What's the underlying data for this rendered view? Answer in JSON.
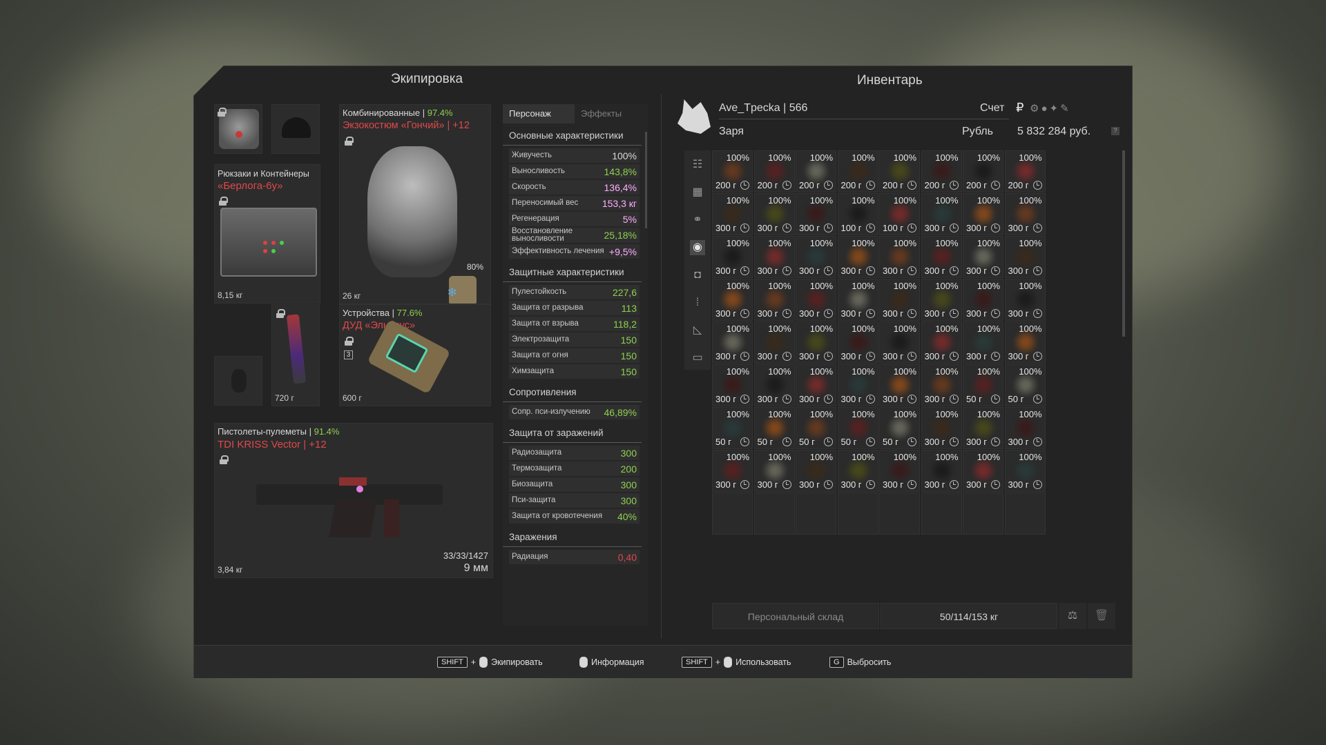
{
  "equipment": {
    "title": "Экипировка",
    "backpack": {
      "category": "Рюкзаки и Контейнеры",
      "name": "«Берлога-6у»",
      "weight": "8,15 кг"
    },
    "armor": {
      "category": "Комбинированные",
      "durability": "97.4%",
      "name": "Экзокостюм «Гончий» | +12",
      "weight": "26 кг",
      "plate_pct": "80%"
    },
    "knife": {
      "weight": "720 г"
    },
    "device": {
      "category": "Устройства",
      "durability": "77.6%",
      "name": "ДУД «Эльбрус»",
      "weight": "600 г",
      "badge": "3"
    },
    "weapon": {
      "category": "Пистолеты-пулеметы",
      "durability": "91.4%",
      "name": "TDI KRISS Vector | +12",
      "weight": "3,84 кг",
      "ammo": "33/33/1427",
      "caliber": "9 мм"
    }
  },
  "stats": {
    "tab_character": "Персонаж",
    "tab_effects": "Эффекты",
    "sections": [
      {
        "title": "Основные характеристики",
        "rows": [
          {
            "label": "Живучесть",
            "value": "100%",
            "color": "w"
          },
          {
            "label": "Выносливость",
            "value": "143,8%",
            "color": "g"
          },
          {
            "label": "Скорость",
            "value": "136,4%",
            "color": "p"
          },
          {
            "label": "Переносимый вес",
            "value": "153,3 кг",
            "color": "p"
          },
          {
            "label": "Регенерация",
            "value": "5%",
            "color": "p"
          },
          {
            "label": "Восстановление выносливости",
            "value": "25,18%",
            "color": "g"
          },
          {
            "label": "Эффективность лечения",
            "value": "+9,5%",
            "color": "p"
          }
        ]
      },
      {
        "title": "Защитные характеристики",
        "rows": [
          {
            "label": "Пулестойкость",
            "value": "227,6",
            "color": "g"
          },
          {
            "label": "Защита от разрыва",
            "value": "113",
            "color": "g"
          },
          {
            "label": "Защита от взрыва",
            "value": "118,2",
            "color": "g"
          },
          {
            "label": "Электрозащита",
            "value": "150",
            "color": "g"
          },
          {
            "label": "Защита от огня",
            "value": "150",
            "color": "g"
          },
          {
            "label": "Химзащита",
            "value": "150",
            "color": "g"
          }
        ]
      },
      {
        "title": "Сопротивления",
        "rows": [
          {
            "label": "Сопр. пси-излучению",
            "value": "46,89%",
            "color": "g"
          }
        ]
      },
      {
        "title": "Защита от заражений",
        "rows": [
          {
            "label": "Радиозащита",
            "value": "300",
            "color": "g"
          },
          {
            "label": "Термозащита",
            "value": "200",
            "color": "g"
          },
          {
            "label": "Биозащита",
            "value": "300",
            "color": "g"
          },
          {
            "label": "Пси-защита",
            "value": "300",
            "color": "g"
          },
          {
            "label": "Защита от кровотечения",
            "value": "40%",
            "color": "g"
          }
        ]
      },
      {
        "title": "Заражения",
        "rows": [
          {
            "label": "Радиация",
            "value": "0,40",
            "color": "r"
          }
        ]
      }
    ]
  },
  "inventory": {
    "title": "Инвентарь",
    "player": "Ave_Tpecka | 566",
    "faction": "Заря",
    "account_label": "Счет",
    "currency_label": "Рубль",
    "balance": "5 832 284 руб.",
    "storage_label": "Персональный склад",
    "weight": "50/114/153 кг",
    "grid": [
      [
        "200 г",
        "200 г",
        "200 г",
        "200 г",
        "200 г",
        "200 г",
        "200 г",
        "200 г"
      ],
      [
        "300 г",
        "300 г",
        "300 г",
        "100 г",
        "100 г",
        "300 г",
        "300 г",
        "300 г"
      ],
      [
        "300 г",
        "300 г",
        "300 г",
        "300 г",
        "300 г",
        "300 г",
        "300 г",
        "300 г"
      ],
      [
        "300 г",
        "300 г",
        "300 г",
        "300 г",
        "300 г",
        "300 г",
        "300 г",
        "300 г"
      ],
      [
        "300 г",
        "300 г",
        "300 г",
        "300 г",
        "300 г",
        "300 г",
        "300 г",
        "300 г"
      ],
      [
        "300 г",
        "300 г",
        "300 г",
        "300 г",
        "300 г",
        "300 г",
        "50 г",
        "50 г"
      ],
      [
        "50 г",
        "50 г",
        "50 г",
        "50 г",
        "50 г",
        "300 г",
        "300 г",
        "300 г"
      ],
      [
        "300 г",
        "300 г",
        "300 г",
        "300 г",
        "300 г",
        "300 г",
        "300 г",
        "300 г"
      ]
    ],
    "grid_pct": "100%"
  },
  "footer": {
    "shift": "SHIFT",
    "plus": "+",
    "equip": "Экипировать",
    "info": "Информация",
    "use": "Использовать",
    "g_key": "G",
    "drop": "Выбросить"
  }
}
